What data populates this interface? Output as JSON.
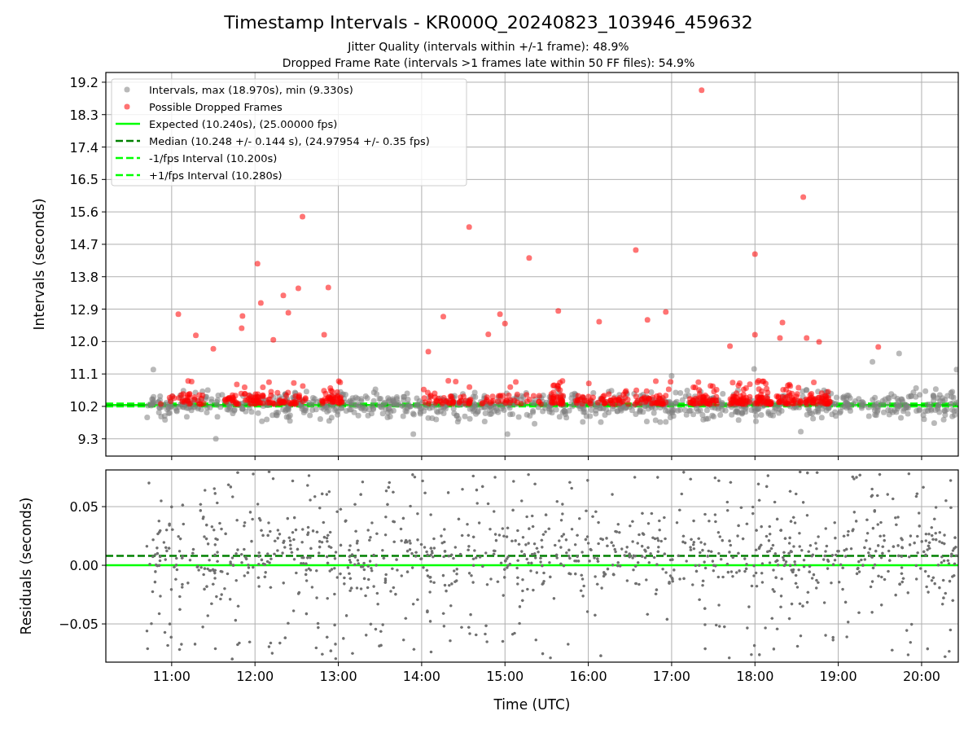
{
  "title": "Timestamp Intervals - KR000Q_20240823_103946_459632",
  "subtitles": [
    "Jitter Quality (intervals within +/-1 frame): 48.9%",
    "Dropped Frame Rate (intervals >1 frames late within 50 FF files): 54.9%"
  ],
  "charts": [
    {
      "chart_data": {
        "type": "scatter",
        "ylabel": "Intervals (seconds)",
        "xlim": [
          10.21,
          20.44
        ],
        "ylim": [
          8.82,
          19.47
        ],
        "grid": true,
        "legend": true,
        "yticks": [
          {
            "value": 9.3,
            "label": "9.3"
          },
          {
            "value": 10.2,
            "label": "10.2"
          },
          {
            "value": 11.1,
            "label": "11.1"
          },
          {
            "value": 12.0,
            "label": "12.0"
          },
          {
            "value": 12.9,
            "label": "12.9"
          },
          {
            "value": 13.8,
            "label": "13.8"
          },
          {
            "value": 14.7,
            "label": "14.7"
          },
          {
            "value": 15.6,
            "label": "15.6"
          },
          {
            "value": 16.5,
            "label": "16.5"
          },
          {
            "value": 17.4,
            "label": "17.4"
          },
          {
            "value": 18.3,
            "label": "18.3"
          },
          {
            "value": 19.2,
            "label": "19.2"
          }
        ],
        "series": [
          {
            "name": "Intervals, max (18.970s), min (9.330s)",
            "color": "#808080",
            "x": [
              10.78,
              20.42,
              19.41,
              19.73,
              11.53,
              17.99,
              15.03,
              13.9,
              17.0,
              18.55
            ],
            "values": [
              11.22,
              11.22,
              11.44,
              11.67,
              9.3,
              11.24,
              9.43,
              9.43,
              11.05,
              9.5
            ]
          },
          {
            "name": "Possible Dropped Frames",
            "color": "#ff0000",
            "x": [
              11.08,
              12.03,
              12.57,
              12.07,
              12.34,
              12.52,
              12.88,
              11.84,
              11.85,
              11.29,
              14.57,
              15.29,
              16.57,
              17.36,
              18.58,
              18.0,
              16.93,
              15.64,
              14.26,
              14.08,
              14.94,
              16.13,
              16.71,
              18.0,
              18.33,
              18.77,
              19.48,
              17.7,
              12.83,
              12.22,
              11.5,
              12.4,
              14.8,
              15.0,
              18.3,
              18.62
            ],
            "values": [
              12.76,
              14.16,
              15.47,
              13.07,
              13.28,
              13.48,
              13.5,
              12.37,
              12.71,
              12.17,
              15.18,
              14.32,
              14.54,
              18.98,
              16.01,
              14.43,
              12.82,
              12.85,
              12.69,
              11.72,
              12.76,
              12.55,
              12.6,
              12.19,
              12.53,
              11.99,
              11.85,
              11.87,
              12.19,
              12.05,
              11.8,
              12.8,
              12.2,
              12.5,
              12.1,
              12.1
            ]
          }
        ],
        "ref_lines": [
          {
            "axis": "y",
            "label": "Expected (10.240s), (25.00000 fps)",
            "value": 10.24,
            "color": "#00ff00"
          },
          {
            "axis": "y",
            "label": "Median (10.248 +/- 0.144 s), (24.97954 +/- 0.35 fps)",
            "value": 10.248,
            "color": "#008000"
          },
          {
            "axis": "y",
            "label": "-1/fps Interval (10.200s)",
            "value": 10.2,
            "color": "#00ff00"
          },
          {
            "axis": "y",
            "label": "+1/fps Interval (10.280s)",
            "value": 10.28,
            "color": "#00ff00"
          }
        ]
      }
    },
    {
      "chart_data": {
        "type": "scatter",
        "grid": true,
        "xlabel": "Time (UTC)",
        "ylabel": "Residuals (seconds)",
        "xlim": [
          10.21,
          20.44
        ],
        "ylim": [
          -0.0826,
          0.0813
        ],
        "xticks": [
          {
            "value": 11,
            "label": "11:00"
          },
          {
            "value": 12,
            "label": "12:00"
          },
          {
            "value": 13,
            "label": "13:00"
          },
          {
            "value": 14,
            "label": "14:00"
          },
          {
            "value": 15,
            "label": "15:00"
          },
          {
            "value": 16,
            "label": "16:00"
          },
          {
            "value": 17,
            "label": "17:00"
          },
          {
            "value": 18,
            "label": "18:00"
          },
          {
            "value": 19,
            "label": "19:00"
          },
          {
            "value": 20,
            "label": "20:00"
          }
        ],
        "yticks": [
          {
            "value": -0.05,
            "label": "−0.05"
          },
          {
            "value": 0,
            "label": "0.00"
          },
          {
            "value": 0.05,
            "label": "0.05"
          }
        ],
        "ref_lines": [
          {
            "axis": "y",
            "value": 0,
            "color": "#00ff00"
          },
          {
            "axis": "y",
            "value": 0.008,
            "color": "#008000"
          }
        ]
      }
    }
  ]
}
